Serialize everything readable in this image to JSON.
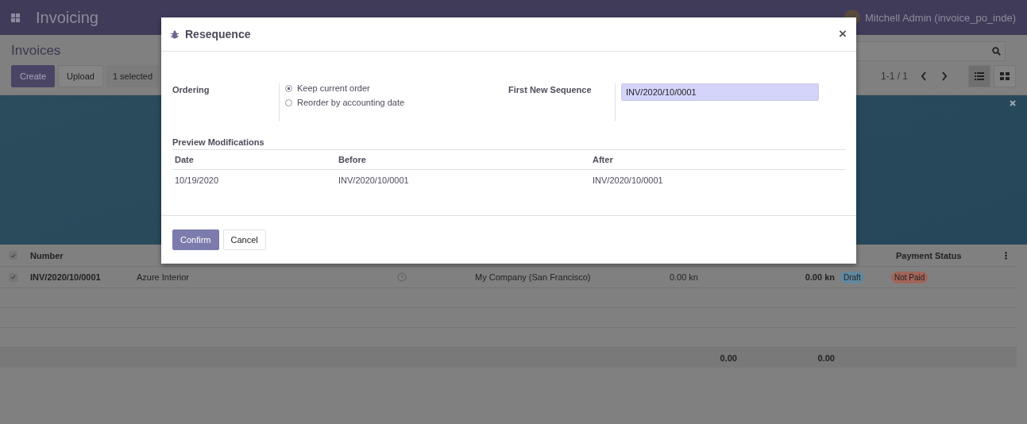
{
  "topbar": {
    "app_title": "Invoicing",
    "user": "Mitchell Admin (invoice_po_inde)"
  },
  "control_panel": {
    "title": "Invoices",
    "buttons": [
      {
        "label": "Create",
        "kind": "primary"
      },
      {
        "label": "Upload",
        "kind": "secondary"
      }
    ],
    "selection": "1 selected",
    "pager": "1-1 / 1",
    "views": [
      {
        "kind": "list",
        "selected": true
      },
      {
        "kind": "kanban",
        "selected": false
      }
    ]
  },
  "list": {
    "all_checked": true,
    "columns": [
      "Number",
      "Payment Status"
    ],
    "rows": [
      {
        "checked": true,
        "number": "INV/2020/10/0001",
        "customer": "Azure Interior",
        "company": "My Company (San Francisco)",
        "untaxed": "0.00 kn",
        "total": "0.00 kn",
        "status": "Draft",
        "payment": "Not Paid"
      }
    ],
    "totals": [
      "0.00",
      "0.00"
    ]
  },
  "dialog": {
    "title": "Resequence",
    "close": "×",
    "ordering": {
      "label": "Ordering",
      "options": [
        {
          "label": "Keep current order",
          "selected": true
        },
        {
          "label": "Reorder by accounting date",
          "selected": false
        }
      ]
    },
    "first_sequence": {
      "label": "First New Sequence",
      "value": "INV/2020/10/0001"
    },
    "preview": {
      "title": "Preview Modifications",
      "columns": [
        "Date",
        "Before",
        "After"
      ],
      "rows": [
        [
          "10/19/2020",
          "INV/2020/10/0001",
          "INV/2020/10/0001"
        ]
      ]
    },
    "buttons": [
      {
        "label": "Confirm",
        "kind": "primary"
      },
      {
        "label": "Cancel",
        "kind": "secondary"
      }
    ]
  }
}
